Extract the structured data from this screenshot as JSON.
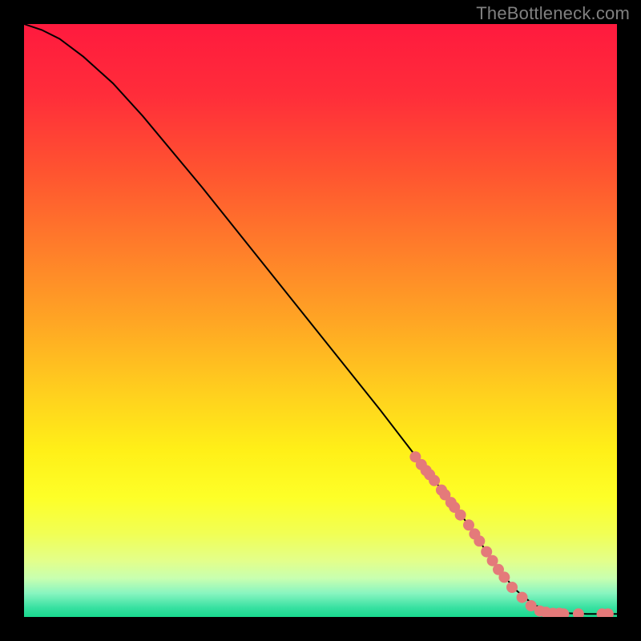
{
  "watermark": "TheBottleneck.com",
  "colors": {
    "background_black": "#000000",
    "watermark_gray": "#808080",
    "curve_black": "#000000",
    "point_fill": "#e47a7a",
    "gradient_stops": [
      {
        "offset": 0.0,
        "color": "#ff1a3e"
      },
      {
        "offset": 0.12,
        "color": "#ff2d3a"
      },
      {
        "offset": 0.25,
        "color": "#ff5430"
      },
      {
        "offset": 0.38,
        "color": "#ff7e2a"
      },
      {
        "offset": 0.5,
        "color": "#ffa524"
      },
      {
        "offset": 0.62,
        "color": "#ffcf1e"
      },
      {
        "offset": 0.72,
        "color": "#fff018"
      },
      {
        "offset": 0.8,
        "color": "#fdff28"
      },
      {
        "offset": 0.86,
        "color": "#f1ff55"
      },
      {
        "offset": 0.905,
        "color": "#e3ff8a"
      },
      {
        "offset": 0.935,
        "color": "#c8ffb0"
      },
      {
        "offset": 0.96,
        "color": "#88f5c0"
      },
      {
        "offset": 0.985,
        "color": "#36e0a0"
      },
      {
        "offset": 1.0,
        "color": "#19d98e"
      }
    ]
  },
  "chart_data": {
    "type": "line",
    "title": "",
    "xlabel": "",
    "ylabel": "",
    "xlim": [
      0,
      100
    ],
    "ylim": [
      0,
      100
    ],
    "series": [
      {
        "name": "curve",
        "x": [
          0,
          3,
          6,
          10,
          15,
          20,
          30,
          40,
          50,
          60,
          70,
          75,
          78,
          80,
          83,
          86,
          90,
          95,
          100
        ],
        "y": [
          100,
          99,
          97.5,
          94.5,
          90,
          84.5,
          72.5,
          60,
          47.5,
          35,
          22,
          15.5,
          11,
          8,
          4.5,
          2,
          0.7,
          0.5,
          0.5
        ]
      }
    ],
    "scatter_points": [
      {
        "x": 66.0,
        "y": 27.0
      },
      {
        "x": 67.0,
        "y": 25.7
      },
      {
        "x": 67.8,
        "y": 24.7
      },
      {
        "x": 68.4,
        "y": 24.0
      },
      {
        "x": 69.2,
        "y": 23.0
      },
      {
        "x": 70.4,
        "y": 21.4
      },
      {
        "x": 71.0,
        "y": 20.6
      },
      {
        "x": 72.0,
        "y": 19.3
      },
      {
        "x": 72.6,
        "y": 18.5
      },
      {
        "x": 73.6,
        "y": 17.2
      },
      {
        "x": 75.0,
        "y": 15.5
      },
      {
        "x": 76.0,
        "y": 14.0
      },
      {
        "x": 76.8,
        "y": 12.8
      },
      {
        "x": 78.0,
        "y": 11.0
      },
      {
        "x": 79.0,
        "y": 9.5
      },
      {
        "x": 80.0,
        "y": 8.0
      },
      {
        "x": 81.0,
        "y": 6.7
      },
      {
        "x": 82.3,
        "y": 5.0
      },
      {
        "x": 84.0,
        "y": 3.3
      },
      {
        "x": 85.5,
        "y": 1.9
      },
      {
        "x": 87.0,
        "y": 1.0
      },
      {
        "x": 88.0,
        "y": 0.8
      },
      {
        "x": 89.2,
        "y": 0.6
      },
      {
        "x": 90.3,
        "y": 0.6
      },
      {
        "x": 91.0,
        "y": 0.5
      },
      {
        "x": 93.5,
        "y": 0.5
      },
      {
        "x": 97.5,
        "y": 0.5
      },
      {
        "x": 98.5,
        "y": 0.5
      }
    ]
  }
}
